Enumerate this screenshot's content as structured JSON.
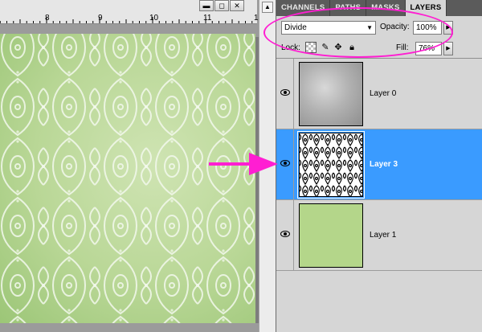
{
  "ruler": {
    "labels": [
      "8",
      "9",
      "10",
      "11",
      "1"
    ]
  },
  "window_controls": {
    "minimize": "▬",
    "restore": "◻",
    "close": "✕"
  },
  "panel": {
    "tabs": [
      {
        "label": "CHANNELS",
        "active": false
      },
      {
        "label": "PATHS",
        "active": false
      },
      {
        "label": "MASKS",
        "active": false
      },
      {
        "label": "LAYERS",
        "active": true
      }
    ],
    "blend_mode": "Divide",
    "opacity_label": "Opacity:",
    "opacity_value": "100%",
    "lock_label": "Lock:",
    "lock_icons": [
      "lock-transparency-icon",
      "lock-paint-icon",
      "lock-move-icon",
      "lock-all-icon"
    ],
    "fill_label": "Fill:",
    "fill_value": "76%"
  },
  "layers": [
    {
      "name": "Layer 0",
      "thumbnail": "gray-texture",
      "visible": true,
      "selected": false
    },
    {
      "name": "Layer 3",
      "thumbnail": "pattern",
      "visible": true,
      "selected": true
    },
    {
      "name": "Layer 1",
      "thumbnail": "green-fill",
      "visible": true,
      "selected": false
    }
  ],
  "colors": {
    "canvas_green": "#b9d796",
    "selection_blue": "#3a9bff",
    "annotation_magenta": "#ff1ed2",
    "tab_bar": "#5b5b5b"
  }
}
